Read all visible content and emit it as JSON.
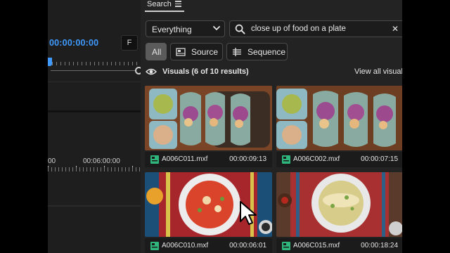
{
  "timeline": {
    "timecode": "00:00:00:00",
    "overflow_label": "F",
    "ruler_label_left": "00",
    "ruler_label_mid": "00:06:00:00"
  },
  "search_panel": {
    "tab_label": "Search",
    "scope_dropdown": {
      "selected": "Everything"
    },
    "query": "close up of food on a plate",
    "filters": [
      {
        "label": "All",
        "active": true
      },
      {
        "label": "Source",
        "active": false
      },
      {
        "label": "Sequence",
        "active": false
      }
    ],
    "results_title": "Visuals (6 of 10 results)",
    "view_all_label": "View all visuals"
  },
  "clips": [
    {
      "name": "A006C011.mxf",
      "duration": "00:00:09:13"
    },
    {
      "name": "A006C002.mxf",
      "duration": "00:00:07:15"
    },
    {
      "name": "A006C010.mxf",
      "duration": "00:00:06:01"
    },
    {
      "name": "A006C015.mxf",
      "duration": "00:00:18:24"
    }
  ],
  "colors": {
    "accent_blue": "#3f9bff",
    "panel_bg": "#232323",
    "active_filter_bg": "#5b5b5b",
    "clip_icon_green": "#2fb67c"
  }
}
